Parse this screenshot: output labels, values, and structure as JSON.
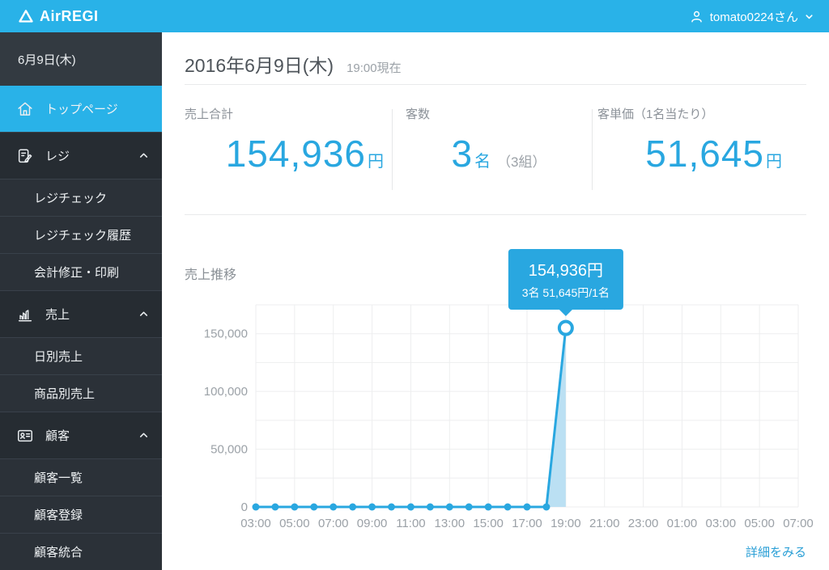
{
  "header": {
    "brand": "AirREGI",
    "user_name": "tomato0224さん"
  },
  "sidebar": {
    "date_label": "6月9日(木)",
    "items": [
      {
        "label": "トップページ",
        "icon": "home-icon",
        "type": "parent",
        "active": true
      },
      {
        "label": "レジ",
        "icon": "register-icon",
        "type": "group",
        "expanded": true
      },
      {
        "label": "レジチェック",
        "type": "sub"
      },
      {
        "label": "レジチェック履歴",
        "type": "sub"
      },
      {
        "label": "会計修正・印刷",
        "type": "sub"
      },
      {
        "label": "売上",
        "icon": "sales-icon",
        "type": "group",
        "expanded": true
      },
      {
        "label": "日別売上",
        "type": "sub"
      },
      {
        "label": "商品別売上",
        "type": "sub"
      },
      {
        "label": "顧客",
        "icon": "customer-icon",
        "type": "group",
        "expanded": true
      },
      {
        "label": "顧客一覧",
        "type": "sub"
      },
      {
        "label": "顧客登録",
        "type": "sub"
      },
      {
        "label": "顧客統合",
        "type": "sub"
      }
    ]
  },
  "main": {
    "date_title": "2016年6月9日(木)",
    "as_of": "19:00現在",
    "stats": [
      {
        "label": "売上合計",
        "value": "154,936",
        "unit": "円",
        "extra": ""
      },
      {
        "label": "客数",
        "value": "3",
        "unit": "名",
        "extra": "（3組）"
      },
      {
        "label": "客単価（1名当たり）",
        "value": "51,645",
        "unit": "円",
        "extra": ""
      }
    ],
    "tooltip": {
      "line1": "154,936円",
      "line2": "3名 51,645円/1名"
    },
    "detail_link": "詳細をみる"
  },
  "colors": {
    "header_bg": "#29B2E8",
    "accent_blue": "#29A7E0",
    "area_fill": "#BBE0F3",
    "sidebar_bg": "#262C32",
    "grid": "#EDEEEF"
  },
  "chart_data": {
    "type": "area",
    "title": "売上推移",
    "x": [
      "03:00",
      "04:00",
      "05:00",
      "06:00",
      "07:00",
      "08:00",
      "09:00",
      "10:00",
      "11:00",
      "12:00",
      "13:00",
      "14:00",
      "15:00",
      "16:00",
      "17:00",
      "18:00",
      "19:00"
    ],
    "values": [
      0,
      0,
      0,
      0,
      0,
      0,
      0,
      0,
      0,
      0,
      0,
      0,
      0,
      0,
      0,
      0,
      154936
    ],
    "highlight": {
      "x": "19:00",
      "value": 154936,
      "label": "154,936円",
      "sub_label": "3名 51,645円/1名"
    },
    "x_tick_labels": [
      "03:00",
      "05:00",
      "07:00",
      "09:00",
      "11:00",
      "13:00",
      "15:00",
      "17:00",
      "19:00",
      "21:00",
      "23:00",
      "01:00",
      "03:00",
      "05:00",
      "07:00"
    ],
    "x_span_hours": 28,
    "y_ticks": [
      0,
      50000,
      100000,
      150000
    ],
    "y_tick_labels": [
      "0",
      "50,000",
      "100,000",
      "150,000"
    ],
    "ylim": [
      0,
      175000
    ],
    "y_grid_step": 25000,
    "grid": true,
    "legend": "none",
    "line_color": "#29A7E0",
    "area_color": "#BBE0F3"
  }
}
